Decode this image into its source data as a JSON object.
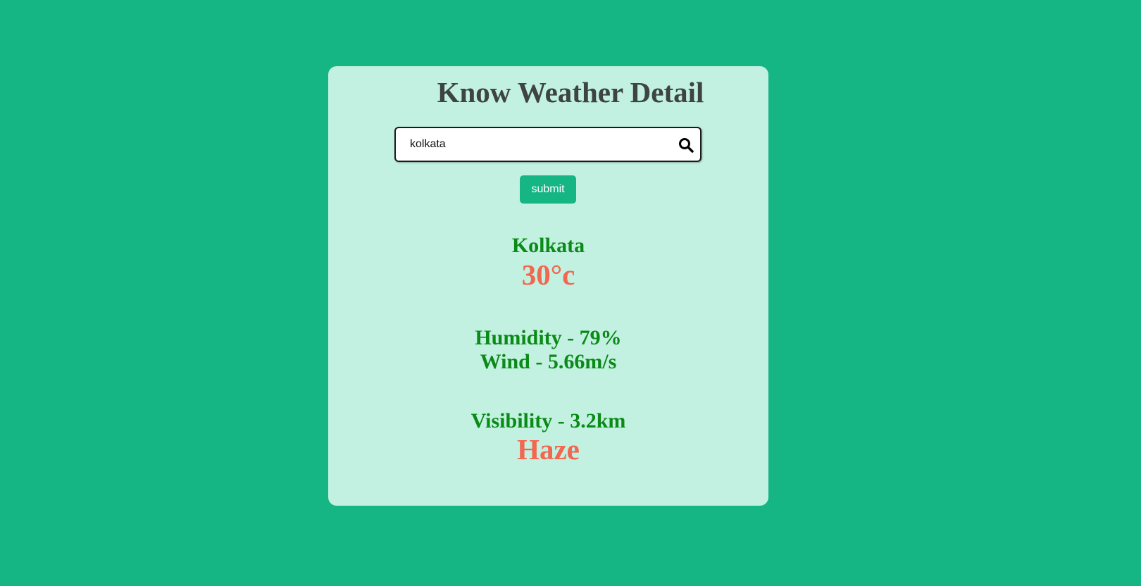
{
  "app": {
    "title": "Know Weather Detail"
  },
  "search": {
    "value": "kolkata",
    "icon": "search-icon"
  },
  "actions": {
    "submit_label": "submit"
  },
  "weather": {
    "city": "Kolkata",
    "temperature": "30°c",
    "humidity": "Humidity - 79%",
    "wind": "Wind - 5.66m/s",
    "visibility": "Visibility - 3.2km",
    "condition": "Haze"
  },
  "colors": {
    "background": "#16b584",
    "card": "#c2f1e1",
    "title": "#3d4441",
    "detail_text": "#0a8a16",
    "highlight_text": "#f2674f",
    "button": "#16b584"
  }
}
